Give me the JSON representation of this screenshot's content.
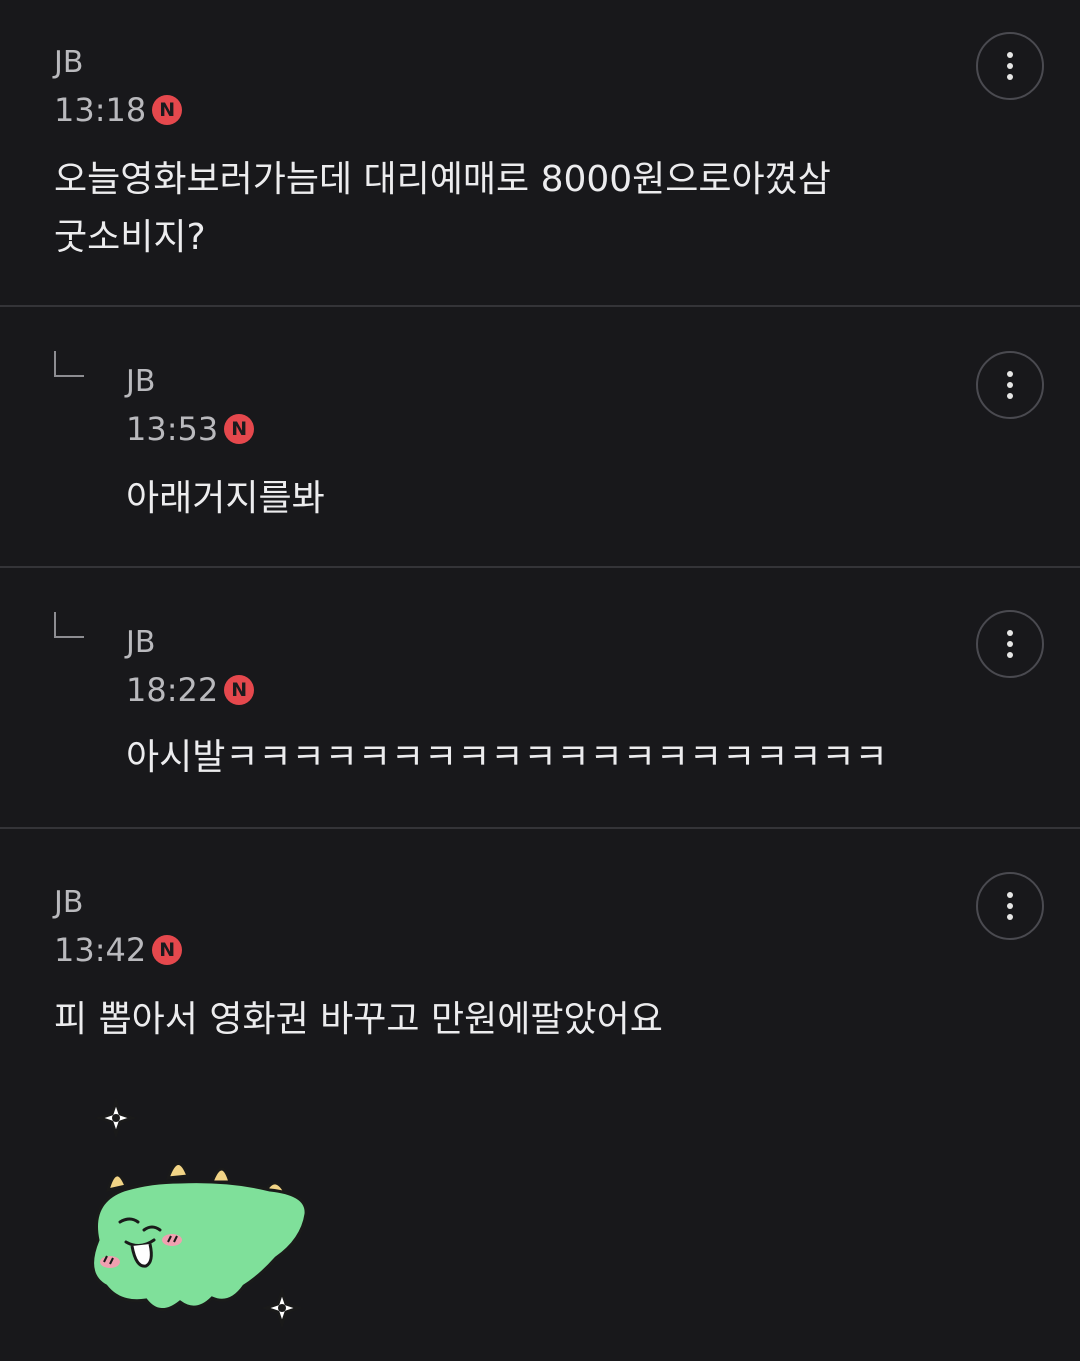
{
  "comments": [
    {
      "author": "JB",
      "time": "13:18",
      "badge": "N",
      "text": "오늘영화보러가늠데 대리예매로 8000원으로아꼈삼\n굿소비지?",
      "is_reply": false
    },
    {
      "author": "JB",
      "time": "13:53",
      "badge": "N",
      "text": "아래거지를봐",
      "is_reply": true
    },
    {
      "author": "JB",
      "time": "18:22",
      "badge": "N",
      "text": "아시발ㅋㅋㅋㅋㅋㅋㅋㅋㅋㅋㅋㅋㅋㅋㅋㅋㅋㅋㅋㅋ",
      "is_reply": true
    },
    {
      "author": "JB",
      "time": "13:42",
      "badge": "N",
      "text": "피 뽑아서 영화권 바꾸고 만원에팔았어요",
      "is_reply": false
    }
  ],
  "icons": {
    "more": "more-vertical-icon",
    "reply": "reply-arrow-icon",
    "sticker": "green-dinosaur-sticker"
  },
  "colors": {
    "background": "#18181b",
    "badge": "#e5484d",
    "divider": "#343438",
    "sticker_green": "#7fe09a"
  }
}
